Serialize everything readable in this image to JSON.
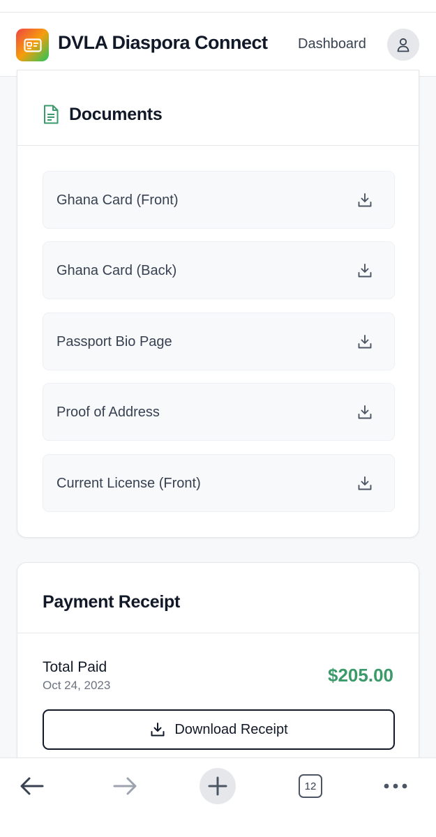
{
  "header": {
    "app_title": "DVLA Diaspora Connect",
    "nav_dashboard": "Dashboard",
    "logo_icon": "id-card-icon",
    "avatar_icon": "user-icon"
  },
  "documents": {
    "title": "Documents",
    "icon": "document-icon",
    "items": [
      {
        "label": "Ghana Card (Front)",
        "icon": "download-icon"
      },
      {
        "label": "Ghana Card (Back)",
        "icon": "download-icon"
      },
      {
        "label": "Passport Bio Page",
        "icon": "download-icon"
      },
      {
        "label": "Proof of Address",
        "icon": "download-icon"
      },
      {
        "label": "Current License (Front)",
        "icon": "download-icon"
      }
    ]
  },
  "payment": {
    "title": "Payment Receipt",
    "total_label": "Total Paid",
    "date": "Oct 24, 2023",
    "amount": "$205.00",
    "amount_color": "#3a9a6a",
    "download_label": "Download Receipt"
  },
  "browser": {
    "tab_count": "12",
    "icons": [
      "back-arrow-icon",
      "forward-arrow-icon",
      "plus-icon",
      "tabs-icon",
      "more-icon"
    ]
  }
}
